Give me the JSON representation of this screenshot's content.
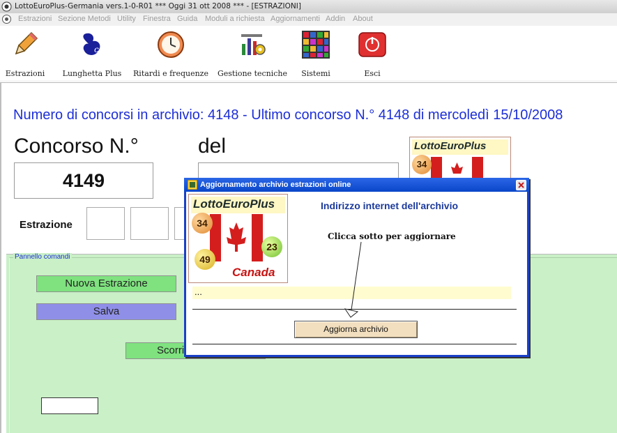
{
  "window": {
    "title": "LottoEuroPlus-Germania vers.1-0-R01   ***   Oggi 31 ott 2008   ***   - [ESTRAZIONI]"
  },
  "menu": [
    "Estrazioni",
    "Sezione Metodi",
    "Utility",
    "Finestra",
    "Guida",
    "Moduli a richiesta",
    "Aggiornamenti",
    "Addin",
    "About"
  ],
  "toolbar": [
    {
      "label": "Estrazioni",
      "icon": "pencil-icon"
    },
    {
      "label": "Lunghetta Plus",
      "icon": "lottery-hand-icon"
    },
    {
      "label": "Ritardi e frequenze",
      "icon": "clock-icon"
    },
    {
      "label": "Gestione tecniche",
      "icon": "tools-chart-icon"
    },
    {
      "label": "Sistemi",
      "icon": "grid-icon"
    },
    {
      "label": "Esci",
      "icon": "power-icon"
    }
  ],
  "main": {
    "info": "Numero di concorsi in archivio: 4148   -   Ultimo concorso N.° 4148 di mercoledì 15/10/2008",
    "concorso_label": "Concorso N.°",
    "del_label": "del",
    "concorso_value": "4149",
    "del_value": "",
    "estrazione_label": "Estrazione"
  },
  "logo": {
    "title": "LottoEuroPlus",
    "country": "Canada",
    "balls": [
      "34",
      "23",
      "49"
    ]
  },
  "panel": {
    "legend": "Pannello comandi",
    "nuova_label": "Nuova Estrazione",
    "salva_label": "Salva",
    "scorri_label": "Scorri"
  },
  "dialog": {
    "title": "Aggiornamento archivio estrazioni online",
    "heading": "Indirizzo internet dell'archivio",
    "instruction": "Clicca sotto per aggiornare",
    "url": "...",
    "button_label": "Aggiorna archivio"
  },
  "colors": {
    "accent_blue": "#1d2fd6",
    "panel_green": "#c9f0c7",
    "button_green": "#7fe27f",
    "button_purple": "#8f8fe8",
    "dialog_titlebar": "#0a47c9"
  }
}
